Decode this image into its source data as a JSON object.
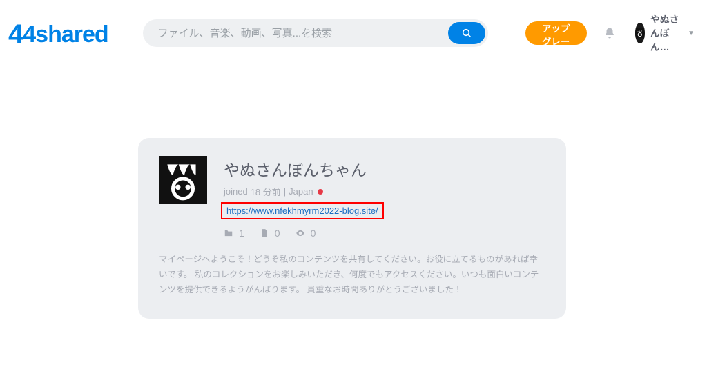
{
  "brand": "4shared",
  "header": {
    "search_placeholder": "ファイル、音楽、動画、写真...を検索",
    "upgrade_label": "アップグレード",
    "user_name_short": "やぬさんぼん… "
  },
  "profile": {
    "display_name": "やぬさんぼんちゃん",
    "joined_prefix": "joined",
    "joined_time": "18 分前",
    "location": "Japan",
    "website_url": "https://www.nfekhmyrm2022-blog.site/",
    "stats": {
      "folders": "1",
      "files": "0",
      "views": "0"
    },
    "description": "マイページへようこそ！どうぞ私のコンテンツを共有してください。お役に立てるものがあれば幸いです。 私のコレクションをお楽しみいただき、何度でもアクセスください。いつも面白いコンテンツを提供できるようがんばります。 貴重なお時間ありがとうございました！"
  }
}
